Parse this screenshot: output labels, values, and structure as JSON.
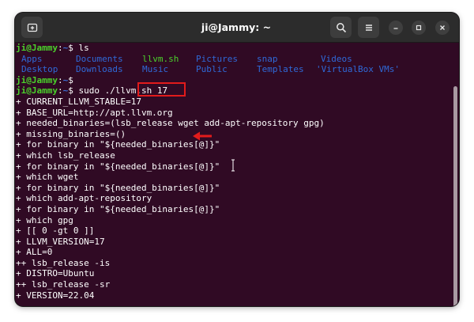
{
  "window": {
    "title": "ji@Jammy: ~"
  },
  "colors": {
    "terminal_bg": "#300a24",
    "prompt_user": "#4ad22b",
    "prompt_path": "#3b6fd6",
    "directory": "#2f69d8",
    "executable": "#4ad22b",
    "annotation": "#e21b1b"
  },
  "icons": {
    "new_tab": "new-tab-icon",
    "search": "search-icon",
    "menu": "hamburger-menu-icon",
    "minimize": "minimize-icon",
    "maximize": "maximize-icon",
    "close": "close-icon"
  },
  "prompt": {
    "user": "ji@Jammy",
    "sep": ":",
    "path": "~",
    "symbol": "$"
  },
  "session": {
    "cmd1": "ls",
    "ls_row1": [
      "Apps",
      "Documents",
      "llvm.sh",
      "Pictures",
      "snap",
      "Videos"
    ],
    "ls_row2": [
      "Desktop",
      "Downloads",
      "Music",
      "Public",
      "Templates",
      "'VirtualBox VMs'"
    ],
    "cmd2": "",
    "cmd3": "sudo ./llvm.sh 17",
    "output": [
      "+ CURRENT_LLVM_STABLE=17",
      "+ BASE_URL=http://apt.llvm.org",
      "+ needed_binaries=(lsb_release wget add-apt-repository gpg)",
      "+ missing_binaries=()",
      "+ for binary in \"${needed_binaries[@]}\"",
      "+ which lsb_release",
      "+ for binary in \"${needed_binaries[@]}\"",
      "+ which wget",
      "+ for binary in \"${needed_binaries[@]}\"",
      "+ which add-apt-repository",
      "+ for binary in \"${needed_binaries[@]}\"",
      "+ which gpg",
      "+ [[ 0 -gt 0 ]]",
      "+ LLVM_VERSION=17",
      "+ ALL=0",
      "++ lsb_release -is",
      "+ DISTRO=Ubuntu",
      "++ lsb_release -sr",
      "+ VERSION=22.04"
    ]
  }
}
